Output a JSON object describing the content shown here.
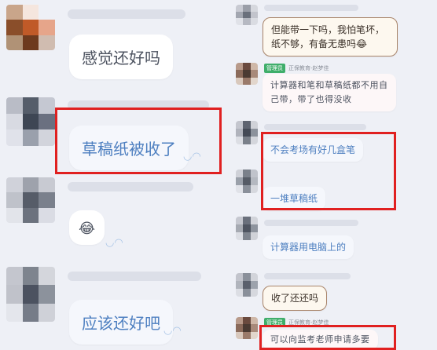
{
  "left": {
    "messages": [
      {
        "text": "感觉还好吗"
      },
      {
        "text": "草稿纸被收了"
      },
      {
        "emoji": "😂"
      },
      {
        "text": "应该还好吧"
      }
    ]
  },
  "right": {
    "messages": [
      {
        "text": "但能带一下吗，我怕笔坏，纸不够，有备无患吗😂"
      },
      {
        "badge": "管理员",
        "sender": "正保教育-赵梦佳",
        "text": "计算器和笔和草稿纸都不用自己带，带了也得没收"
      },
      {
        "text": "不会考场有好几盒笔"
      },
      {
        "text": "一堆草稿纸"
      },
      {
        "text": "计算器用电脑上的"
      },
      {
        "text": "收了还还吗"
      },
      {
        "badge": "管理员",
        "sender": "正保教育-赵梦佳",
        "text": "可以向监考老师申请多要"
      }
    ]
  },
  "colors": {
    "highlight": "#e02020",
    "bubble_border": "#a8846a",
    "admin_badge": "#3fae6a"
  }
}
